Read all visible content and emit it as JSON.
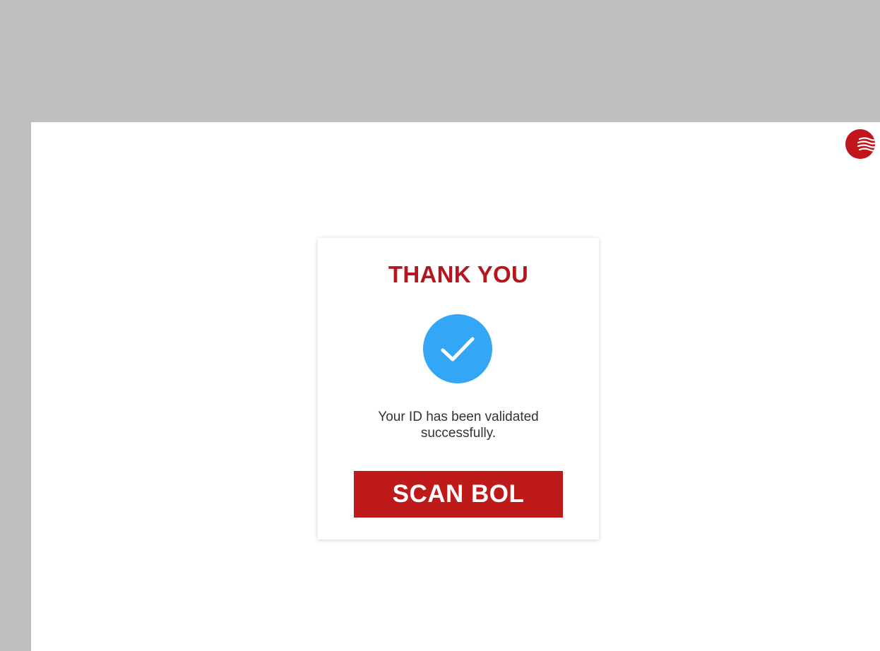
{
  "card": {
    "title": "THANK YOU",
    "message": "Your ID has been validated successfully.",
    "button_label": "SCAN BOL"
  },
  "icons": {
    "logo": "waves-logo-icon",
    "status": "checkmark-icon"
  },
  "colors": {
    "brand_red": "#be1a1a",
    "title_red": "#b5161c",
    "success_blue": "#33a7f5",
    "background_gray": "#bfbfbf"
  }
}
